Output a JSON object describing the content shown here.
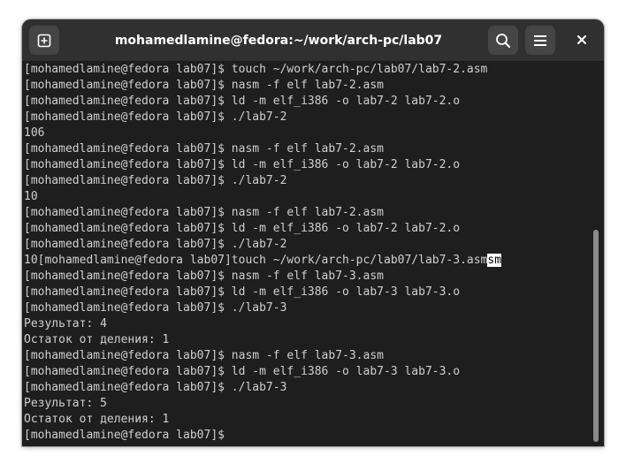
{
  "window": {
    "title": "mohamedlamine@fedora:~/work/arch-pc/lab07"
  },
  "icons": {
    "new_tab": "new-tab-icon",
    "search": "search-icon",
    "menu": "hamburger-menu-icon",
    "close": "close-icon"
  },
  "colors": {
    "titlebar": "#303030",
    "terminal_bg": "#1e1e1e",
    "text": "#d0d0d0",
    "cursor_bg": "#ffffff"
  },
  "terminal": {
    "lines": [
      "[mohamedlamine@fedora lab07]$ touch ~/work/arch-pc/lab07/lab7-2.asm",
      "[mohamedlamine@fedora lab07]$ nasm -f elf lab7-2.asm",
      "[mohamedlamine@fedora lab07]$ ld -m elf_i386 -o lab7-2 lab7-2.o",
      "[mohamedlamine@fedora lab07]$ ./lab7-2",
      "106",
      "[mohamedlamine@fedora lab07]$ nasm -f elf lab7-2.asm",
      "[mohamedlamine@fedora lab07]$ ld -m elf_i386 -o lab7-2 lab7-2.o",
      "[mohamedlamine@fedora lab07]$ ./lab7-2",
      "10",
      "[mohamedlamine@fedora lab07]$ nasm -f elf lab7-2.asm",
      "[mohamedlamine@fedora lab07]$ ld -m elf_i386 -o lab7-2 lab7-2.o",
      "[mohamedlamine@fedora lab07]$ ./lab7-2",
      "10[mohamedlamine@fedora lab07]touch ~/work/arch-pc/lab07/lab7-3.asm",
      "[mohamedlamine@fedora lab07]$ nasm -f elf lab7-3.asm",
      "[mohamedlamine@fedora lab07]$ ld -m elf_i386 -o lab7-3 lab7-3.o",
      "[mohamedlamine@fedora lab07]$ ./lab7-3",
      "Результат: 4",
      "Остаток от деления: 1",
      "[mohamedlamine@fedora lab07]$ nasm -f elf lab7-3.asm",
      "[mohamedlamine@fedora lab07]$ ld -m elf_i386 -o lab7-3 lab7-3.o",
      "[mohamedlamine@fedora lab07]$ ./lab7-3",
      "Результат: 5",
      "Остаток от деления: 1",
      "[mohamedlamine@fedora lab07]$ "
    ],
    "cursor_text": "sm"
  }
}
